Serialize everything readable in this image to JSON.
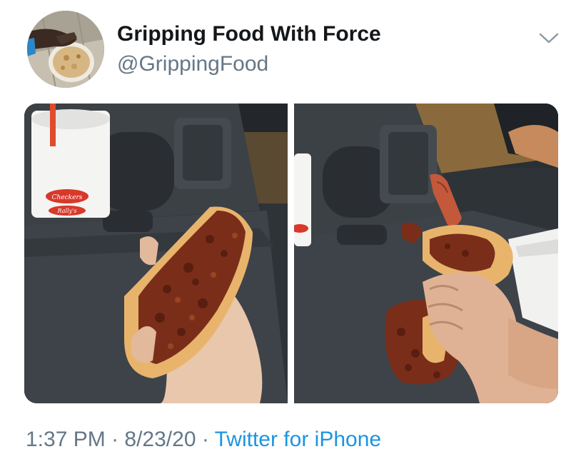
{
  "tweet": {
    "display_name": "Gripping Food With Force",
    "handle": "@GrippingFood",
    "timestamp": {
      "time": "1:37 PM",
      "separator": " · ",
      "date": "8/23/20",
      "source": "Twitter for iPhone"
    }
  },
  "icons": {
    "more": "chevron-down-icon"
  },
  "colors": {
    "text_primary": "#14171a",
    "text_secondary": "#657786",
    "link": "#1b95e0"
  },
  "cup_print": {
    "brand": "Checkers",
    "sub": "Rally's"
  }
}
